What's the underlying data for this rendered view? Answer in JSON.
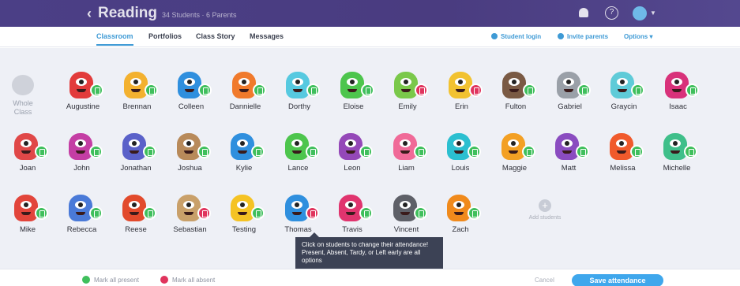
{
  "topbar": {
    "back_glyph": "‹",
    "title": "Reading",
    "subtitle": "34 Students · 6 Parents",
    "help": "?"
  },
  "nav": {
    "tabs": [
      "Classroom",
      "Portfolios",
      "Class Story",
      "Messages"
    ],
    "actions": [
      "Student login",
      "Invite parents",
      "Options ▾"
    ]
  },
  "whole_class": "Whole Class",
  "rows": [
    [
      {
        "name": "Augustine",
        "status": "present",
        "color": "#e23b3b"
      },
      {
        "name": "Brennan",
        "status": "present",
        "color": "#f3b12f"
      },
      {
        "name": "Colleen",
        "status": "present",
        "color": "#2f8fde"
      },
      {
        "name": "Dannielle",
        "status": "present",
        "color": "#f07a2c"
      },
      {
        "name": "Dorthy",
        "status": "present",
        "color": "#56c9e0"
      },
      {
        "name": "Eloise",
        "status": "present",
        "color": "#4dc54d"
      },
      {
        "name": "Emily",
        "status": "absent",
        "color": "#7ac84a"
      },
      {
        "name": "Erin",
        "status": "absent",
        "color": "#f2c230"
      },
      {
        "name": "Fulton",
        "status": "present",
        "color": "#7a5a44"
      },
      {
        "name": "Gabriel",
        "status": "present",
        "color": "#9aa0a8"
      },
      {
        "name": "Graycin",
        "status": "present",
        "color": "#5fcbd8"
      },
      {
        "name": "Isaac",
        "status": "present",
        "color": "#d8327a"
      }
    ],
    [
      {
        "name": "Joan",
        "status": "present",
        "color": "#e04848"
      },
      {
        "name": "John",
        "status": "present",
        "color": "#c43ea4"
      },
      {
        "name": "Jonathan",
        "status": "present",
        "color": "#5a61c9"
      },
      {
        "name": "Joshua",
        "status": "present",
        "color": "#b88a5a"
      },
      {
        "name": "Kylie",
        "status": "present",
        "color": "#2f8fde"
      },
      {
        "name": "Lance",
        "status": "present",
        "color": "#4dc54d"
      },
      {
        "name": "Leon",
        "status": "present",
        "color": "#9448b8"
      },
      {
        "name": "Liam",
        "status": "present",
        "color": "#f06a98"
      },
      {
        "name": "Louis",
        "status": "present",
        "color": "#2bbfd0"
      },
      {
        "name": "Maggie",
        "status": "present",
        "color": "#f3a024"
      },
      {
        "name": "Matt",
        "status": "present",
        "color": "#8a4cc0"
      },
      {
        "name": "Melissa",
        "status": "present",
        "color": "#f05a2c"
      },
      {
        "name": "Michelle",
        "status": "present",
        "color": "#3fbf8a"
      }
    ],
    [
      {
        "name": "Mike",
        "status": "present",
        "color": "#e2453b"
      },
      {
        "name": "Rebecca",
        "status": "present",
        "color": "#4a7ad8"
      },
      {
        "name": "Reese",
        "status": "present",
        "color": "#e24a2c"
      },
      {
        "name": "Sebastian",
        "status": "absent",
        "color": "#c9a06a"
      },
      {
        "name": "Testing",
        "status": "present",
        "color": "#f5c324"
      },
      {
        "name": "Thomas",
        "status": "absent",
        "color": "#2f8fde"
      },
      {
        "name": "Travis",
        "status": "present",
        "color": "#e0346e"
      },
      {
        "name": "Vincent",
        "status": "present",
        "color": "#5e6068"
      },
      {
        "name": "Zach",
        "status": "present",
        "color": "#f08a1c"
      }
    ]
  ],
  "add_students": "Add students",
  "tooltip": "Click on students to change their attendance! Present, Absent, Tardy, or Left early are all options",
  "footer": {
    "mark_present": "Mark all present",
    "mark_absent": "Mark all absent",
    "cancel": "Cancel",
    "save": "Save attendance"
  },
  "colors": {
    "header": "#4b3f86",
    "accent": "#3e9ad5",
    "present": "#3fbf5c",
    "absent": "#e0345d"
  }
}
